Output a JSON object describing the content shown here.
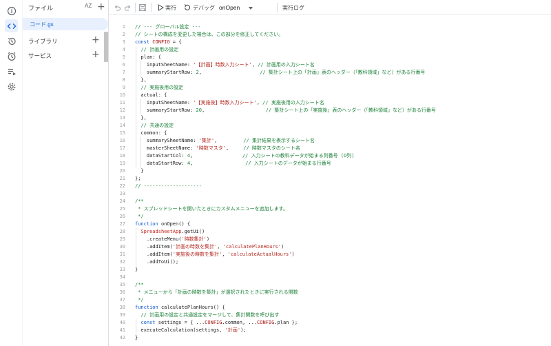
{
  "rail": {
    "items": [
      {
        "name": "info-icon"
      },
      {
        "name": "code-icon",
        "active": true
      },
      {
        "name": "history-icon"
      },
      {
        "name": "triggers-icon"
      },
      {
        "name": "executions-icon"
      },
      {
        "name": "settings-icon"
      }
    ]
  },
  "files": {
    "title": "ファイル",
    "sort_label": "AZ",
    "add_label": "+",
    "items": [
      "コード.gs"
    ],
    "sections": [
      {
        "label": "ライブラリ",
        "add": "+"
      },
      {
        "label": "サービス",
        "add": "+"
      }
    ]
  },
  "toolbar": {
    "run_label": "実行",
    "debug_label": "デバッグ",
    "function_name": "onOpen",
    "log_label": "実行ログ"
  },
  "colors": {
    "accent": "#1967d2",
    "active_bg": "#e8f0fe",
    "comment": "#1a7f37",
    "keyword": "#0b57d0",
    "string": "#b3261e"
  },
  "editor": {
    "lines": [
      {
        "n": "1",
        "t": [
          [
            "cm",
            "// --- グローバル設定 ---"
          ]
        ]
      },
      {
        "n": "2",
        "t": [
          [
            "cm",
            "// シートの構成を変更した場合は、この部分を修正してください。"
          ]
        ]
      },
      {
        "n": "3",
        "t": [
          [
            "kw",
            "const "
          ],
          [
            "id",
            "CONFIG"
          ],
          [
            "p",
            " = {"
          ]
        ]
      },
      {
        "n": "4",
        "t": [
          [
            "p",
            "  "
          ],
          [
            "cm",
            "// 計画用の設定"
          ]
        ]
      },
      {
        "n": "5",
        "t": [
          [
            "p",
            "  plan: {"
          ]
        ]
      },
      {
        "n": "6",
        "t": [
          [
            "p",
            "    inputSheetName: "
          ],
          [
            "str",
            "'【計画】時数入力シート'"
          ],
          [
            "p",
            ", "
          ],
          [
            "cm",
            "// 計画用の入力シート名"
          ]
        ]
      },
      {
        "n": "7",
        "t": [
          [
            "p",
            "    summaryStartRow: "
          ],
          [
            "num",
            "2"
          ],
          [
            "p",
            ",                    "
          ],
          [
            "cm",
            "// 集計シート上の「計画」表のヘッダー（「教科領域」など）がある行番号"
          ]
        ]
      },
      {
        "n": "8",
        "t": [
          [
            "p",
            "  },"
          ]
        ]
      },
      {
        "n": "9",
        "t": [
          [
            "p",
            "  "
          ],
          [
            "cm",
            "// 実施後用の設定"
          ]
        ]
      },
      {
        "n": "10",
        "t": [
          [
            "p",
            "  actual: {"
          ]
        ]
      },
      {
        "n": "11",
        "t": [
          [
            "p",
            "    inputSheetName: "
          ],
          [
            "str",
            "'【実施後】時数入力シート'"
          ],
          [
            "p",
            ", "
          ],
          [
            "cm",
            "// 実施後用の入力シート名"
          ]
        ]
      },
      {
        "n": "12",
        "t": [
          [
            "p",
            "    summaryStartRow: "
          ],
          [
            "num",
            "20"
          ],
          [
            "p",
            ",                     "
          ],
          [
            "cm",
            "// 集計シート上の「実施後」表のヘッダー（「教科領域」など）がある行番号"
          ]
        ]
      },
      {
        "n": "13",
        "t": [
          [
            "p",
            "  },"
          ]
        ]
      },
      {
        "n": "14",
        "t": [
          [
            "p",
            "  "
          ],
          [
            "cm",
            "// 共通の設定"
          ]
        ]
      },
      {
        "n": "15",
        "t": [
          [
            "p",
            "  common: {"
          ]
        ]
      },
      {
        "n": "16",
        "t": [
          [
            "p",
            "    summarySheetName: "
          ],
          [
            "str",
            "'集計'"
          ],
          [
            "p",
            ",         "
          ],
          [
            "cm",
            "// 集計結果を表示するシート名"
          ]
        ]
      },
      {
        "n": "17",
        "t": [
          [
            "p",
            "    masterSheetName: "
          ],
          [
            "str",
            "'時数マスタ'"
          ],
          [
            "p",
            ",     "
          ],
          [
            "cm",
            "// 時数マスタのシート名"
          ]
        ]
      },
      {
        "n": "18",
        "t": [
          [
            "p",
            "    dataStartCol: "
          ],
          [
            "num",
            "4"
          ],
          [
            "p",
            ",                 "
          ],
          [
            "cm",
            "// 入力シートの教科データが始まる列番号 (D列)"
          ]
        ]
      },
      {
        "n": "19",
        "t": [
          [
            "p",
            "    dataStartRow: "
          ],
          [
            "num",
            "4"
          ],
          [
            "p",
            ",                  "
          ],
          [
            "cm",
            "// 入力シートのデータが始まる行番号"
          ]
        ]
      },
      {
        "n": "20",
        "t": [
          [
            "p",
            "  }"
          ]
        ]
      },
      {
        "n": "21",
        "t": [
          [
            "p",
            "};"
          ]
        ]
      },
      {
        "n": "22",
        "t": [
          [
            "cm",
            "// --------------------"
          ]
        ]
      },
      {
        "n": "23",
        "t": []
      },
      {
        "n": "24",
        "t": [
          [
            "cm",
            "/**"
          ]
        ]
      },
      {
        "n": "25",
        "t": [
          [
            "cm",
            " * スプレッドシートを開いたときにカスタムメニューを追加します。"
          ]
        ]
      },
      {
        "n": "26",
        "t": [
          [
            "cm",
            " */"
          ]
        ]
      },
      {
        "n": "27",
        "t": [
          [
            "kw",
            "function "
          ],
          [
            "fn",
            "onOpen"
          ],
          [
            "p",
            "() {"
          ]
        ]
      },
      {
        "n": "28",
        "t": [
          [
            "p",
            "  "
          ],
          [
            "cls",
            "SpreadsheetApp"
          ],
          [
            "p",
            ".getUi()"
          ]
        ]
      },
      {
        "n": "29",
        "t": [
          [
            "p",
            "    .createMenu("
          ],
          [
            "str",
            "'時数集計'"
          ],
          [
            "p",
            ")"
          ]
        ]
      },
      {
        "n": "30",
        "t": [
          [
            "p",
            "    .addItem("
          ],
          [
            "str",
            "'計画の時数を集計'"
          ],
          [
            "p",
            ", "
          ],
          [
            "str",
            "'calculatePlanHours'"
          ],
          [
            "p",
            ")"
          ]
        ]
      },
      {
        "n": "31",
        "t": [
          [
            "p",
            "    .addItem("
          ],
          [
            "str",
            "'実施後の時数を集計'"
          ],
          [
            "p",
            ", "
          ],
          [
            "str",
            "'calculateActualHours'"
          ],
          [
            "p",
            ")"
          ]
        ]
      },
      {
        "n": "32",
        "t": [
          [
            "p",
            "    .addToUi();"
          ]
        ]
      },
      {
        "n": "33",
        "t": [
          [
            "p",
            "}"
          ]
        ]
      },
      {
        "n": "34",
        "t": []
      },
      {
        "n": "35",
        "t": [
          [
            "cm",
            "/**"
          ]
        ]
      },
      {
        "n": "36",
        "t": [
          [
            "cm",
            " * メニューから「計画の時数を集計」が選択されたときに実行される関数"
          ]
        ]
      },
      {
        "n": "37",
        "t": [
          [
            "cm",
            " */"
          ]
        ]
      },
      {
        "n": "38",
        "t": [
          [
            "kw",
            "function "
          ],
          [
            "fn",
            "calculatePlanHours"
          ],
          [
            "p",
            "() {"
          ]
        ]
      },
      {
        "n": "39",
        "t": [
          [
            "p",
            "  "
          ],
          [
            "cm",
            "// 計画用の設定と共通設定をマージして、集計関数を呼び出す"
          ]
        ]
      },
      {
        "n": "40",
        "t": [
          [
            "p",
            "  "
          ],
          [
            "kw",
            "const "
          ],
          [
            "p",
            "settings = { ..."
          ],
          [
            "id",
            "CONFIG"
          ],
          [
            "p",
            ".common, ..."
          ],
          [
            "id",
            "CONFIG"
          ],
          [
            "p",
            ".plan };"
          ]
        ]
      },
      {
        "n": "41",
        "t": [
          [
            "p",
            "  executeCalculation(settings, "
          ],
          [
            "str",
            "'計画'"
          ],
          [
            "p",
            ");"
          ]
        ]
      },
      {
        "n": "42",
        "t": [
          [
            "p",
            "}"
          ]
        ]
      }
    ]
  }
}
